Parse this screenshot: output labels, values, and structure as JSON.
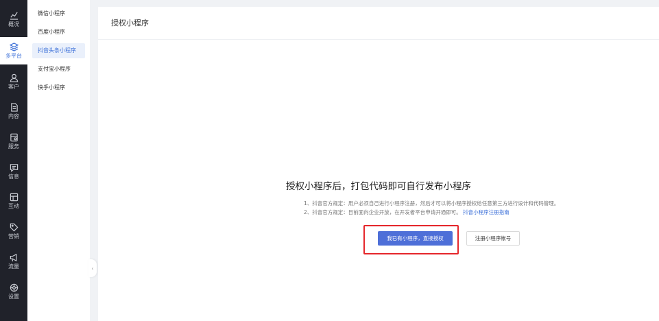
{
  "rail": {
    "items": [
      {
        "label": "概况",
        "icon": "chart-icon"
      },
      {
        "label": "多平台",
        "icon": "layers-icon"
      },
      {
        "label": "客户",
        "icon": "user-icon"
      },
      {
        "label": "内容",
        "icon": "document-icon"
      },
      {
        "label": "服务",
        "icon": "service-icon"
      },
      {
        "label": "信息",
        "icon": "message-icon"
      },
      {
        "label": "互动",
        "icon": "interaction-icon"
      },
      {
        "label": "营销",
        "icon": "tag-icon"
      },
      {
        "label": "流量",
        "icon": "megaphone-icon"
      },
      {
        "label": "设置",
        "icon": "settings-icon"
      }
    ],
    "active": "多平台"
  },
  "subnav": {
    "items": [
      {
        "label": "微信小程序"
      },
      {
        "label": "百度小程序"
      },
      {
        "label": "抖音头条小程序"
      },
      {
        "label": "支付宝小程序"
      },
      {
        "label": "快手小程序"
      }
    ],
    "active": "抖音头条小程序"
  },
  "panel": {
    "title": "授权小程序",
    "headline": "授权小程序后，打包代码即可自行发布小程序",
    "notes": [
      {
        "text": "1、抖音官方规定：用户必须自己进行小程序注册，然后才可以将小程序授权给任意第三方进行设计和代码管理。"
      },
      {
        "text": "2、抖音官方规定：目前面向企业开放，在开发者平台申请开通即可。",
        "link": "抖音小程序注册指南"
      }
    ],
    "primary_button": "我已有小程序，直接授权",
    "secondary_button": "注册小程序帐号"
  },
  "colors": {
    "rail_bg": "#20222a",
    "accent": "#3b6fd8",
    "primary_button": "#4e6fd8",
    "highlight_border": "#e5262b"
  }
}
